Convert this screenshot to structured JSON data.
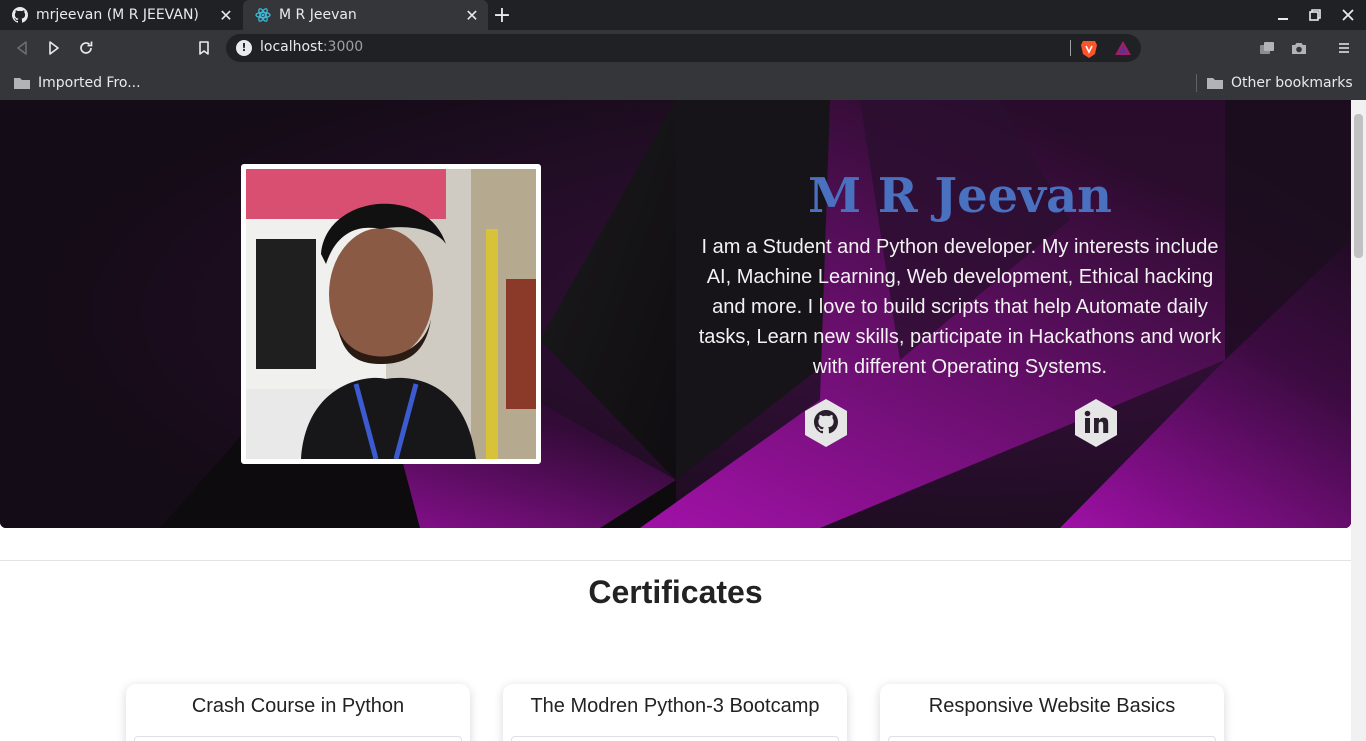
{
  "browser": {
    "tabs": [
      {
        "title": "mrjeevan (M R JEEVAN)",
        "icon": "github-icon",
        "active": false
      },
      {
        "title": "M R Jeevan",
        "icon": "react-icon",
        "active": true
      }
    ],
    "url_host": "localhost",
    "url_port": ":3000",
    "bookmarks": {
      "left": "Imported Fro...",
      "right": "Other bookmarks"
    }
  },
  "hero": {
    "name": "M R Jeevan",
    "bio": "I am a Student and Python developer. My interests include AI, Machine Learning, Web development, Ethical hacking and more. I love to build scripts that help Automate daily tasks, Learn new skills, participate in Hackathons and work with different Operating Systems.",
    "social": [
      {
        "icon": "github-icon"
      },
      {
        "icon": "linkedin-icon"
      }
    ]
  },
  "certificates": {
    "title": "Certificates",
    "items": [
      {
        "title": "Crash Course in Python"
      },
      {
        "title": "The Modren Python-3 Bootcamp"
      },
      {
        "title": "Responsive Website Basics"
      }
    ]
  },
  "colors": {
    "name": "#4a70c0",
    "chrome_dark": "#202124",
    "chrome": "#35363a",
    "hero_purple": "#8a1490"
  }
}
